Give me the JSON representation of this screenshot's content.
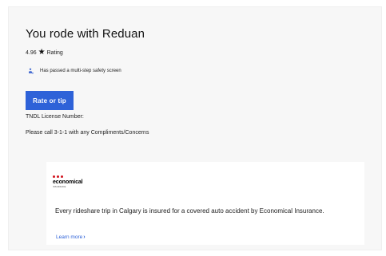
{
  "card": {
    "title": "You rode with Reduan",
    "rating_value": "4.96",
    "rating_label": "Rating",
    "safety_text": "Has passed a multi-step safety screen",
    "rate_button_label": "Rate or tip",
    "tndl_label": "TNDL License Number:",
    "call_text": "Please call 3-1-1 with any Compliments/Concerns"
  },
  "insurance": {
    "logo_word": "economical",
    "logo_sub": "INSURANCE",
    "text": "Every rideshare trip in Calgary is insured for a covered auto accident by Economical Insurance.",
    "learn_more_label": "Learn more",
    "learn_more_chevron": "›"
  },
  "colors": {
    "accent_blue": "#2e62d8",
    "logo_red": "#d1141e",
    "card_bg": "#f7f7f7"
  },
  "icons": {
    "star": "star-icon",
    "shield": "shield-person-icon",
    "chevron": "chevron-right-icon"
  }
}
